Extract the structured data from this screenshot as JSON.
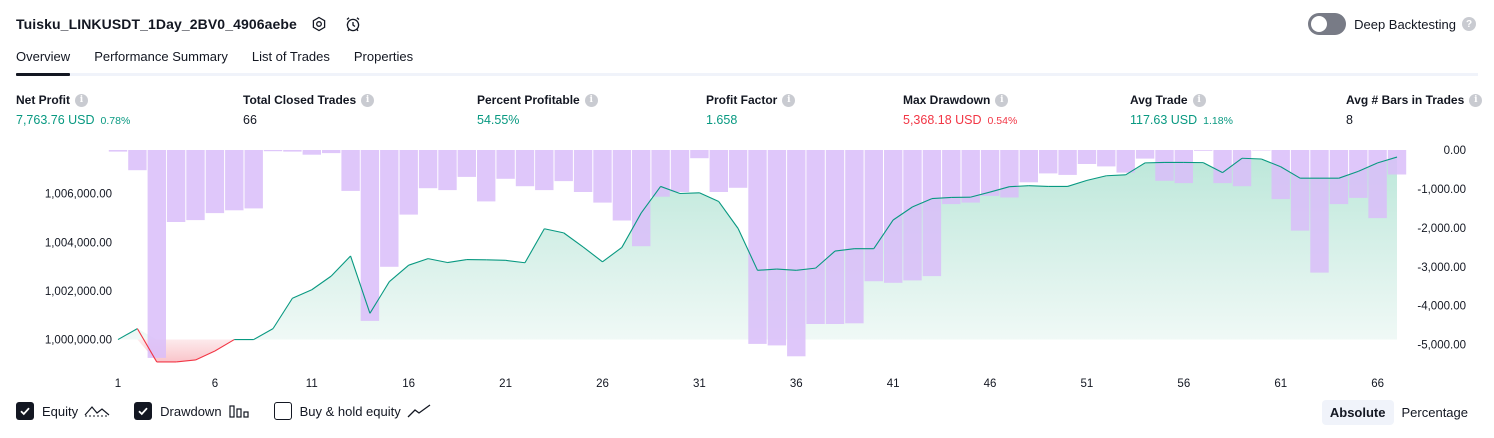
{
  "header": {
    "title": "Tuisku_LINKUSDT_1Day_2BV0_4906aebe",
    "icons": [
      "settings-icon",
      "alert-icon"
    ]
  },
  "deep_backtesting": {
    "label": "Deep Backtesting",
    "enabled": false,
    "help_icon": "question-icon"
  },
  "tabs": [
    {
      "label": "Overview",
      "active": true
    },
    {
      "label": "Performance Summary",
      "active": false
    },
    {
      "label": "List of Trades",
      "active": false
    },
    {
      "label": "Properties",
      "active": false
    }
  ],
  "metrics": [
    {
      "label": "Net Profit",
      "value": "7,763.76 USD",
      "pct": "0.78%",
      "tone": "pos"
    },
    {
      "label": "Total Closed Trades",
      "value": "66",
      "pct": "",
      "tone": "neutral"
    },
    {
      "label": "Percent Profitable",
      "value": "54.55%",
      "pct": "",
      "tone": "pos"
    },
    {
      "label": "Profit Factor",
      "value": "1.658",
      "pct": "",
      "tone": "pos"
    },
    {
      "label": "Max Drawdown",
      "value": "5,368.18 USD",
      "pct": "0.54%",
      "tone": "neg"
    },
    {
      "label": "Avg Trade",
      "value": "117.63 USD",
      "pct": "1.18%",
      "tone": "pos"
    },
    {
      "label": "Avg # Bars in Trades",
      "value": "8",
      "pct": "",
      "tone": "neutral"
    }
  ],
  "chart_data": {
    "type": "area",
    "x": [
      1,
      2,
      3,
      4,
      5,
      6,
      7,
      8,
      9,
      10,
      11,
      12,
      13,
      14,
      15,
      16,
      17,
      18,
      19,
      20,
      21,
      22,
      23,
      24,
      25,
      26,
      27,
      28,
      29,
      30,
      31,
      32,
      33,
      34,
      35,
      36,
      37,
      38,
      39,
      40,
      41,
      42,
      43,
      44,
      45,
      46,
      47,
      48,
      49,
      50,
      51,
      52,
      53,
      54,
      55,
      56,
      57,
      58,
      59,
      60,
      61,
      62,
      63,
      64,
      65,
      66,
      67
    ],
    "x_ticks": [
      "1",
      "6",
      "11",
      "16",
      "21",
      "26",
      "31",
      "36",
      "41",
      "46",
      "51",
      "56",
      "61",
      "66"
    ],
    "left_axis": {
      "ticks": [
        "1,000,000.00",
        "1,002,000.00",
        "1,004,000.00",
        "1,006,000.00"
      ],
      "ylim": [
        999200,
        1007800
      ]
    },
    "right_axis": {
      "ticks": [
        "0.00",
        "-1,000.00",
        "-2,000.00",
        "-3,000.00",
        "-4,000.00",
        "-5,000.00"
      ],
      "ylim": [
        -5368.18,
        0
      ]
    },
    "series": [
      {
        "name": "Equity",
        "color": "#089981",
        "values": [
          1000000,
          1000450,
          999080,
          999080,
          999160,
          999530,
          1000000,
          1000000,
          1000450,
          1001700,
          1002050,
          1002610,
          1003440,
          1001080,
          1002380,
          1003060,
          1003330,
          1003170,
          1003290,
          1003280,
          1003260,
          1003160,
          1004560,
          1004390,
          1003810,
          1003200,
          1003790,
          1005210,
          1006300,
          1006010,
          1006040,
          1005680,
          1004570,
          1002850,
          1002900,
          1002850,
          1002940,
          1003640,
          1003740,
          1003740,
          1004920,
          1005460,
          1005800,
          1005850,
          1005860,
          1006070,
          1006290,
          1006330,
          1006300,
          1006300,
          1006550,
          1006740,
          1006780,
          1007270,
          1007290,
          1007290,
          1007280,
          1006870,
          1007460,
          1007430,
          1007110,
          1006640,
          1006640,
          1006640,
          1006920,
          1007270,
          1007510
        ]
      },
      {
        "name": "Drawdown",
        "color": "#b794f6",
        "values": [
          -40,
          -520,
          -5340,
          -1850,
          -1800,
          -1620,
          -1550,
          -1500,
          -30,
          -40,
          -120,
          -80,
          -1050,
          -4390,
          -3000,
          -1660,
          -980,
          -1030,
          -690,
          -1320,
          -740,
          -930,
          -1030,
          -800,
          -1080,
          -1350,
          -1810,
          -2470,
          -1200,
          -1080,
          -210,
          -1080,
          -970,
          -4980,
          -5020,
          -5300,
          -4470,
          -4470,
          -4450,
          -3370,
          -3410,
          -3350,
          -3240,
          -1390,
          -1350,
          -1180,
          -1220,
          -830,
          -600,
          -640,
          -360,
          -420,
          -580,
          -220,
          -790,
          -850,
          -20,
          -850,
          -930,
          -10,
          -1260,
          -2070,
          -3150,
          -1390,
          -1230,
          -1750,
          -630
        ]
      }
    ],
    "buy_and_hold_visible": false,
    "fill_colors": {
      "equity_above": "#e3f4ef",
      "equity_below": "#fbd5d8"
    },
    "drawdown_fill": "#d9bdf9"
  },
  "legend": {
    "items": [
      {
        "label": "Equity",
        "checked": true,
        "glyph": "equity-line-icon"
      },
      {
        "label": "Drawdown",
        "checked": true,
        "glyph": "drawdown-bars-icon"
      },
      {
        "label": "Buy & hold equity",
        "checked": false,
        "glyph": "buyhold-line-icon"
      }
    ]
  },
  "display_mode": {
    "options": [
      "Absolute",
      "Percentage"
    ],
    "selected": "Absolute"
  }
}
